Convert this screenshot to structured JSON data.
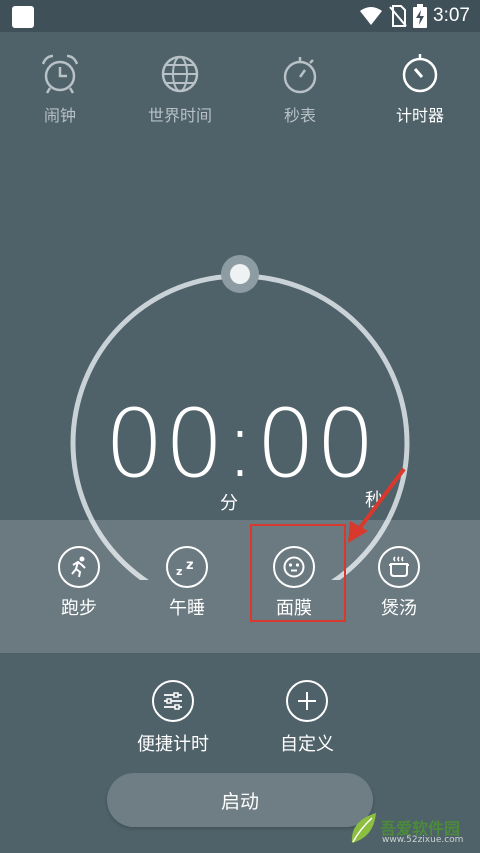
{
  "status_bar": {
    "time": "3:07",
    "icons": [
      "app-square-icon",
      "wifi-icon",
      "no-sim-icon",
      "battery-charging-icon"
    ]
  },
  "tabs": [
    {
      "label": "闹钟",
      "icon": "alarm-clock-icon",
      "active": false
    },
    {
      "label": "世界时间",
      "icon": "globe-icon",
      "active": false
    },
    {
      "label": "秒表",
      "icon": "stopwatch-icon",
      "active": false
    },
    {
      "label": "计时器",
      "icon": "timer-icon",
      "active": true
    }
  ],
  "timer": {
    "minutes": "00",
    "separator": ":",
    "seconds": "00",
    "minutes_unit": "分",
    "seconds_unit": "秒"
  },
  "presets": [
    {
      "label": "跑步",
      "icon": "running-icon"
    },
    {
      "label": "午睡",
      "icon": "sleep-zz-icon"
    },
    {
      "label": "面膜",
      "icon": "face-mask-icon",
      "highlighted": true
    },
    {
      "label": "煲汤",
      "icon": "soup-pot-icon"
    }
  ],
  "actions": [
    {
      "label": "便捷计时",
      "icon": "sliders-icon"
    },
    {
      "label": "自定义",
      "icon": "plus-icon"
    }
  ],
  "start_button": {
    "label": "启动"
  },
  "watermark": {
    "text": "吾爱软件园",
    "url": "www.52zixue.com"
  },
  "colors": {
    "background": "#4f6169",
    "highlight": "#d8392c",
    "button": "#6f7e85"
  }
}
